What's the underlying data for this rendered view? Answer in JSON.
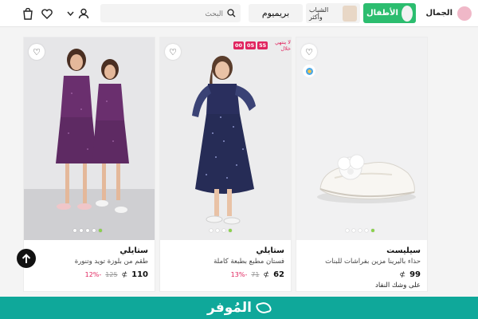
{
  "header": {
    "search_placeholder": "البحث",
    "premium_label": "بريميوم",
    "categories": [
      {
        "label": "الأطفال",
        "active": true
      },
      {
        "label": "الشباب وأكثر",
        "active": false
      }
    ],
    "beauty_label": "الجمال",
    "icons": [
      "cart-icon",
      "heart-icon",
      "chevron-down-icon",
      "user-icon",
      "search-icon"
    ]
  },
  "products": [
    {
      "brand": "سيليست",
      "title": "حذاء باليرينا مزين بفراشات للبنات",
      "price": "99",
      "currency": "⊅",
      "old_price": "",
      "discount": "",
      "note": "على وشك النفاد",
      "has_badge": false,
      "dots": 5,
      "active_dot": 5
    },
    {
      "brand": "ستايلي",
      "title": "فستان مطبع بطبعة كاملة",
      "price": "62",
      "currency": "⊅",
      "old_price": "71",
      "discount": "-13%",
      "note": "",
      "has_badge": true,
      "badge_label": "لا ينتهي خلال",
      "badge_time": [
        "55",
        "05",
        "00"
      ],
      "dots": 4,
      "active_dot": 4
    },
    {
      "brand": "ستايلي",
      "title": "طقم من بلوزة تويد وتنورة",
      "price": "110",
      "currency": "⊅",
      "old_price": "125",
      "discount": "-12%",
      "note": "",
      "has_badge": false,
      "dots": 5,
      "active_dot": 5
    }
  ],
  "footer": {
    "logo_text": "المُوفر"
  },
  "colors": {
    "brand_green": "#2cbd6f",
    "footer_teal": "#0fa89a",
    "discount_red": "#e0245e"
  }
}
